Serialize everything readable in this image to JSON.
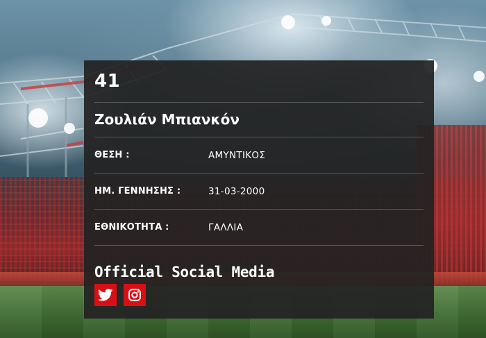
{
  "player": {
    "number": "41",
    "name": "Ζουλιάν Μπιανκόν",
    "details": [
      {
        "label": "ΘΕΣΗ :",
        "value": "ΑΜΥΝΤΙΚΟΣ"
      },
      {
        "label": "ΗΜ. ΓΕΝΝΗΣΗΣ :",
        "value": "31-03-2000"
      },
      {
        "label": "ΕΘΝΙΚΟΤΗΤΑ :",
        "value": "ΓΑΛΛΙΑ"
      }
    ]
  },
  "social": {
    "title": "Official Social Media",
    "links": [
      {
        "icon": "twitter-icon"
      },
      {
        "icon": "instagram-icon"
      }
    ],
    "button_color": "#d90f16"
  },
  "colors": {
    "card_background": "#222222",
    "divider": "#5a5a5a",
    "text": "#ffffff",
    "accent": "#d90f16"
  }
}
